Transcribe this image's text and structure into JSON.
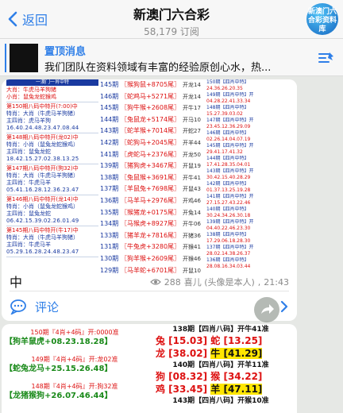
{
  "header": {
    "back_label": "返回",
    "title": "新澳门六合彩",
    "subscribers": "58,179 订阅",
    "avatar_text": "新澳门六合彩资料库"
  },
  "pinned": {
    "title": "置顶消息",
    "text": "我们团队在资料领域有丰富的经验原创心水，热..."
  },
  "post": {
    "image": {
      "left_header": "一澳门一肖中特",
      "left_blocks": [
        {
          "line1": "",
          "line2": "大肖：牛虎马羊狗猪",
          "line3": "小肖：鼠兔龙蛇猴鸡"
        },
        {
          "line1": "第150期八码中特开(?:00)中",
          "line2": "特肖：大肖（牛虎马羊狗猪）",
          "line3": "主四肖：虎马羊狗",
          "nums": "16.40.24.48.23.47.08.44"
        },
        {
          "line1": "第148期八码中特开(龙02)中",
          "line2": "特肖：小肖（鼠兔龙蛇猴鸡）",
          "line3": "主四肖：鼠兔龙蛇",
          "nums": "18.42.15.27.02.38.13.25"
        },
        {
          "line1": "第147期八码中特开(狗32)中",
          "line2": "特肖：大肖（牛虎马羊狗猪）",
          "line3": "主四肖：牛虎马羊",
          "nums": "05.41.16.28.12.36.23.47"
        },
        {
          "line1": "第146期八码中特开(龙14)中",
          "line2": "特肖：小肖（鼠兔龙蛇猴鸡）",
          "line3": "主四肖：鼠兔龙蛇",
          "nums": "06.42.15.39.02.26.01.49"
        },
        {
          "line1": "第145期八码中特开(牛17)中",
          "line2": "特肖：大肖（牛虎马羊狗猪）",
          "line3": "主四肖：牛虎马羊",
          "nums": "05.29.16.28.24.48.23.47"
        }
      ],
      "mid_rows": [
        {
          "idx": "145期",
          "val": "〖猴狗鼠+8705尾〗",
          "res": "开龙14"
        },
        {
          "idx": "146期",
          "val": "〖蛇鸡马+5271尾〗",
          "res": "开龙14"
        },
        {
          "idx": "145期",
          "val": "〖狗牛猴+2608尾〗",
          "res": "开牛17"
        },
        {
          "idx": "144期",
          "val": "〖兔鼠龙+5174尾〗",
          "res": "开马10"
        },
        {
          "idx": "143期",
          "val": "〖蛇羊猴+7014尾〗",
          "res": "开蛇27"
        },
        {
          "idx": "142期",
          "val": "〖蛇狗马+2045尾〗",
          "res": "开羊44"
        },
        {
          "idx": "141期",
          "val": "〖虎蛇马+2376尾〗",
          "res": "开龙50"
        },
        {
          "idx": "139期",
          "val": "〖猪狗虎+3467尾〗",
          "res": "开鼠19"
        },
        {
          "idx": "138期",
          "val": "〖兔鼠猴+3691尾〗",
          "res": "开牛41"
        },
        {
          "idx": "137期",
          "val": "〖羊鼠兔+7698尾〗",
          "res": "开鼠43"
        },
        {
          "idx": "136期",
          "val": "〖马羊马+2976尾〗",
          "res": "开鸡46"
        },
        {
          "idx": "135期",
          "val": "〖猴猪龙+0175尾〗",
          "res": "开兔14"
        },
        {
          "idx": "134期",
          "val": "〖马猴虎+8927尾〗",
          "res": "开牛06"
        },
        {
          "idx": "133期",
          "val": "〖猪羊龙+7816尾〗",
          "res": "开猪36"
        },
        {
          "idx": "131期",
          "val": "〖牛兔虎+3280尾〗",
          "res": "开猴41"
        },
        {
          "idx": "130期",
          "val": "〖狗羊猴+2609尾〗",
          "res": "开猴46"
        },
        {
          "idx": "129期",
          "val": "〖马羊蛇+6701尾〗",
          "res": "开鼠10"
        }
      ],
      "right_rows": [
        {
          "a": "150期【四肖中特】",
          "b": "24.36.26.20.35"
        },
        {
          "a": "149期【四肖中特】开",
          "b": "04.28.22.41.33.34"
        },
        {
          "a": "148期【四肖中特】",
          "b": "15.27.39.03.02"
        },
        {
          "a": "147期【四肖中特】开",
          "b": "23.45.12.36.29.09"
        },
        {
          "a": "146期【四肖中特】",
          "b": "02.26.14.04.07.19"
        },
        {
          "a": "145期【四肖中特】开",
          "b": "29.41.17.41.32"
        },
        {
          "a": "144期【四肖中特】",
          "b": "17.41.28.35.04.01"
        },
        {
          "a": "143期【四肖中特】开",
          "b": "30.42.15.40.28.29"
        },
        {
          "a": "142期【四肖中特】",
          "b": "01.37.13.25.19.28"
        },
        {
          "a": "141期【四肖中特】开",
          "b": "27.15.27.43.22.46"
        },
        {
          "a": "140期【四肖中特】",
          "b": "30.24.34.26.30.18"
        },
        {
          "a": "139期【四肖中特】开",
          "b": "04.40.22.46.23.30"
        },
        {
          "a": "138期【四肖中特】",
          "b": "17.29.06.18.28.30"
        },
        {
          "a": "137期【四肖中特】开",
          "b": "28.02.14.38.26.37"
        },
        {
          "a": "136期【四肖中特】",
          "b": "28.08.16.34.03.44"
        }
      ]
    },
    "text": "中",
    "likes": "288",
    "author": "喜儿 (头像是本人)",
    "time": "21:43",
    "comment_label": "评论"
  },
  "post2": {
    "left": [
      {
        "header": "150期『4肖+4码』开:0000准",
        "green": "【狗羊鼠虎+08.23.18.28】"
      },
      {
        "header": "149期『4肖+4码』开:龙02准",
        "green": "【蛇兔龙马+25.15.26.48】"
      },
      {
        "header": "148期『4肖+4码』开:狗32准",
        "green": "【龙猪猴狗+26.07.46.44】"
      }
    ],
    "right": [
      {
        "header": "138期【四肖八码】开牛41准",
        "l1a": "兔 [15.03] ",
        "l1b": "蛇 [13.25]",
        "l2a": "龙 [38.02] ",
        "l2b": "牛 [41.29]"
      },
      {
        "header": "140期【四肖八码】开羊11准",
        "l1a": "狗 [08.32] ",
        "l1b": "猴 [34.22]",
        "l2a": "鸡 [33.45] ",
        "l2b": "羊 [47.11]"
      },
      {
        "header": "143期【四肖八码】开猴10准",
        "l1a": "",
        "l1b": "",
        "l2a": "",
        "l2b": ""
      }
    ]
  },
  "colors": {
    "accent": "#2f7fe8",
    "red": "#dd1111",
    "green": "#1a8a1a",
    "navy": "#1a3aa0",
    "bg": "#e6e8e5"
  },
  "icons": [
    "chevron-left-icon",
    "pin-list-icon",
    "eye-icon",
    "comment-icon",
    "chevron-right-icon",
    "share-icon"
  ]
}
